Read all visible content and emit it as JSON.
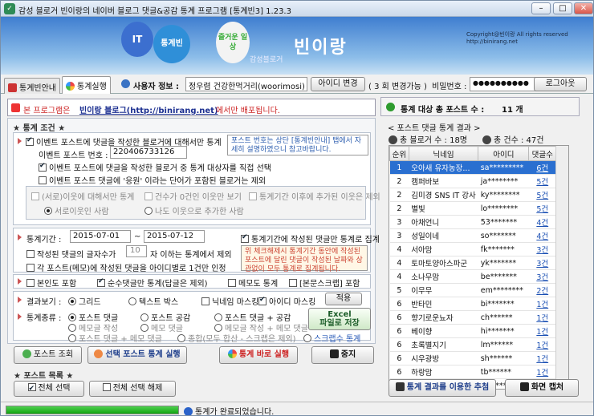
{
  "window": {
    "title": "감성 블로거 빈이랑의 네이버 블로그 댓글&공감 통계 프로그램 [통계빈3] 1.23.3",
    "minimize": "–",
    "maximize": "□",
    "close": "✕"
  },
  "banner": {
    "balloon1": "IT",
    "balloon2": "통계빈",
    "balloon3": "즐거운 일상",
    "title": "빈이랑",
    "subtitle": "감성블로거",
    "copyright1": "Copyright@빈이랑 All rights reserved",
    "copyright2": "http://binirang.net"
  },
  "tabs": [
    {
      "label": "통계빈안내"
    },
    {
      "label": "통계실행"
    }
  ],
  "user": {
    "label": "사용자 정보 :",
    "name": "정우렴 건강한먹거리(woorimosi)",
    "change_btn": "아이디 변경",
    "change_count": "( 3 회 변경가능 )",
    "pw_label": "비밀번호 :",
    "pw_value": "●●●●●●●●●●",
    "logout": "로그아웃"
  },
  "notice": {
    "prefix": "본 프로그램은",
    "link": "빈이랑 블로그(http://binirang.net)",
    "suffix": "에서만 배포됩니다."
  },
  "conditions": {
    "title": "★ 통계 조건 ★",
    "event_only": "이벤트 포스트에 댓글을 작성한 블로거에 대해서만 통계",
    "event_no_label": "이벤트 포스트 번호 :",
    "event_no": "220406733126",
    "select_target": "이벤트 포스트에 댓글을 작성한 블로거 중 통계 대상자를 직접 선택",
    "exclude_apply": "이벤트 포스트 댓글에 '응원' 이라는 단어가 포함된 블로거는 제외",
    "hint1": "포스트 번호는 상단 [통계빈안내] 탭에서 자세히 설명하였으니 참고바랍니다.",
    "neighbor_only": "(서로)이웃에 대해서만 통계",
    "count2": "건수가 0건인 이웃만 보기",
    "exclude_new": "통계기간 이후에 추가된 이웃은 제외",
    "mutual": "서로이웃인 사람",
    "added_me": "나도 이웃으로 추가한 사람",
    "period_label": "통계기간 :",
    "date_from": "2015-07-01",
    "date_to": "2015-07-12",
    "tilde": "~",
    "period_only": "통계기간에 작성된 댓글만 통계로 집계",
    "min_chars_label": "작성된 댓글의 글자수가",
    "min_chars": "10",
    "min_chars_suffix": "자 이하는 통계에서 제외",
    "one_per_post": "각 포스트(메모)에 작성된 댓글을 아이디별로 1건만 인정",
    "hint2": "위 체크해제시 통계기간 동안에 작성된 포스트에 달린 댓글이 작성된 날짜와 상관없이 모두 통계로 집계됩니다.",
    "include_self": "본인도 포함",
    "pure_only": "순수댓글만 통계(답글은 제외)",
    "memo_stats": "메모도 통계",
    "scrap_include": "[본문스크랩] 포함",
    "view_label": "결과보기 :",
    "grid": "그리드",
    "textbox": "텍스트 박스",
    "nick_mask": "닉네임 마스킹",
    "id_mask": "아이디 마스킹",
    "apply": "적용",
    "kind_label": "통계종류 :",
    "k1": "포스트 댓글",
    "k2": "포스트 공감",
    "k3": "포스트 댓글 + 공감",
    "k4": "메모글 작성",
    "k5": "메모 댓글",
    "k6": "메모글 작성 + 메모 댓글",
    "k7": "포스트 댓글 + 메모 댓글",
    "k8": "종합(모두 합산 - 스크랩은 제외)",
    "k9": "스크랩수 통계",
    "excel": "Excel\n파일로 저장"
  },
  "actions": {
    "lookup": "포스트 조회",
    "selected_run": "선택 포스트 통계 실행",
    "run_now": "통계 바로 실행",
    "stop": "중지"
  },
  "postlist": {
    "title": "★ 포스트 목록 ★",
    "select_all": "전체 선택",
    "deselect_all": "전체 선택 해제"
  },
  "right": {
    "target_label": "통계 대상 총 포스트 수 :",
    "target_count": "11 개",
    "result_title": "< 포스트 댓글 통계 결과 >",
    "bloggers": "총 블로거 수 : 18명",
    "total": "총 건수 : 47건",
    "headers": [
      "순위",
      "닉네임",
      "아이디",
      "댓글수"
    ],
    "rows": [
      [
        "1",
        "오아새 유자농장...",
        "sa*********",
        "6건"
      ],
      [
        "2",
        "캠퍼바보",
        "ja********",
        "5건"
      ],
      [
        "2",
        "김미경 SNS IT 강사",
        "ky********",
        "5건"
      ],
      [
        "2",
        "별빛",
        "lo********",
        "5건"
      ],
      [
        "3",
        "아채언니",
        "53*******",
        "4건"
      ],
      [
        "3",
        "성일이네",
        "so*******",
        "4건"
      ],
      [
        "4",
        "서아맘",
        "fk*******",
        "3건"
      ],
      [
        "4",
        "토마토양아스파군",
        "yk*******",
        "3건"
      ],
      [
        "4",
        "소나무맘",
        "be*******",
        "3건"
      ],
      [
        "5",
        "이무무",
        "em********",
        "2건"
      ],
      [
        "6",
        "반타민",
        "bi*******",
        "1건"
      ],
      [
        "6",
        "향기로운뇨자",
        "ch******",
        "1건"
      ],
      [
        "6",
        "베이향",
        "hi*******",
        "1건"
      ],
      [
        "6",
        "초록별지기",
        "lm******",
        "1건"
      ],
      [
        "6",
        "시우광방",
        "sh******",
        "1건"
      ],
      [
        "6",
        "하랑맘",
        "tb******",
        "1건"
      ],
      [
        "6",
        "무한설비",
        "we******",
        "1건"
      ],
      [
        "6",
        "브라...",
        "so******",
        "1건"
      ]
    ],
    "lottery": "통계 결과를 이용한 추첨",
    "capture": "화면 캡처"
  },
  "status": {
    "message": "통계가 완료되었습니다.",
    "progress": 1.0
  }
}
